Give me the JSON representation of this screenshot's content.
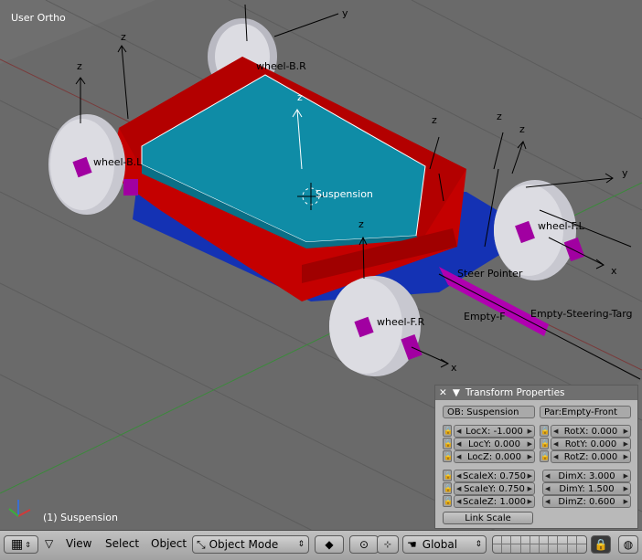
{
  "viewport": {
    "view_name": "User Ortho",
    "status_text": "(1) Suspension",
    "object_labels": {
      "suspension": "Suspension",
      "wheel_back_left": "wheel-B.L",
      "wheel_back_right": "wheel-B.R",
      "wheel_front_left": "wheel-F.L",
      "wheel_front_right": "wheel-F.R",
      "steer_pointer": "Steer Pointer",
      "empty_front": "Empty-F",
      "empty_steering_target": "Empty-Steering-Targ"
    },
    "axis_letters": {
      "x": "x",
      "y": "y",
      "z": "z"
    }
  },
  "transform_panel": {
    "title": "Transform Properties",
    "object_field": "OB: Suspension",
    "parent_field": "Par:Empty-Front",
    "loc": {
      "x": "LocX: -1.000",
      "y": "LocY: 0.000",
      "z": "LocZ: 0.000"
    },
    "rot": {
      "x": "RotX: 0.000",
      "y": "RotY: 0.000",
      "z": "RotZ: 0.000"
    },
    "scale": {
      "x": "ScaleX: 0.750",
      "y": "ScaleY: 0.750",
      "z": "ScaleZ: 1.000"
    },
    "dim": {
      "x": "DimX: 3.000",
      "y": "DimY: 1.500",
      "z": "DimZ: 0.600"
    },
    "link_scale": "Link Scale"
  },
  "header": {
    "menus": [
      "View",
      "Select",
      "Object"
    ],
    "mode": "Object Mode",
    "orientation": "Global"
  },
  "colors": {
    "body_red": "#c40000",
    "body_top_cyan": "#0f8ca6",
    "chassis_blue": "#1432b4",
    "wheel_gray": "#d6d6dc",
    "hub_magenta": "#a100a1"
  }
}
